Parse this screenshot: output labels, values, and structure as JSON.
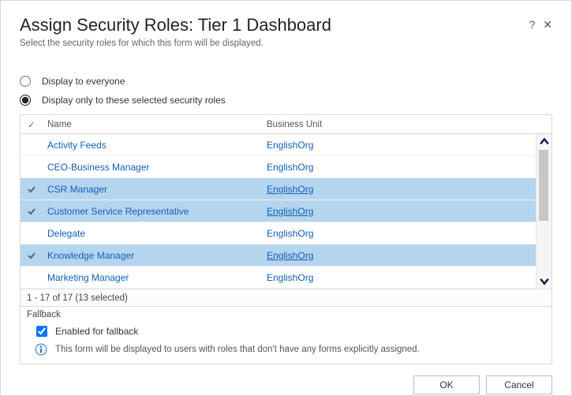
{
  "header": {
    "title": "Assign Security Roles: Tier 1 Dashboard",
    "subtitle": "Select the security roles for which this form will be displayed.",
    "help": "?",
    "close": "✕"
  },
  "options": {
    "everyone": "Display to everyone",
    "selected": "Display only to these selected security roles"
  },
  "table": {
    "headers": {
      "check": "✓",
      "name": "Name",
      "bu": "Business Unit"
    },
    "rows": [
      {
        "name": "Activity Feeds",
        "bu": "EnglishOrg",
        "selected": false
      },
      {
        "name": "CEO-Business Manager",
        "bu": "EnglishOrg",
        "selected": false
      },
      {
        "name": "CSR Manager",
        "bu": "EnglishOrg",
        "selected": true
      },
      {
        "name": "Customer Service Representative",
        "bu": "EnglishOrg",
        "selected": true
      },
      {
        "name": "Delegate",
        "bu": "EnglishOrg",
        "selected": false
      },
      {
        "name": "Knowledge Manager",
        "bu": "EnglishOrg",
        "selected": true
      },
      {
        "name": "Marketing Manager",
        "bu": "EnglishOrg",
        "selected": false
      }
    ],
    "pager": "1 - 17 of 17 (13 selected)"
  },
  "fallback": {
    "title": "Fallback",
    "checkbox": "Enabled for fallback",
    "info": "This form will be displayed to users with roles that don't have any forms explicitly assigned."
  },
  "buttons": {
    "ok": "OK",
    "cancel": "Cancel"
  }
}
